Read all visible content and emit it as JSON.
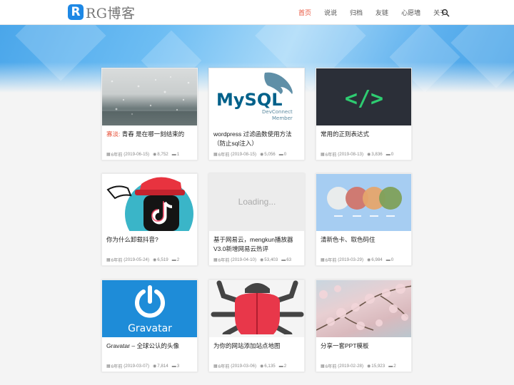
{
  "header": {
    "logo_letter": "R",
    "logo_text": "RG博客",
    "nav": [
      "首页",
      "说说",
      "归档",
      "友链",
      "心愿墙",
      "关于"
    ],
    "active_index": 0,
    "search_icon": "search-icon"
  },
  "colors": {
    "accent": "#e8543c",
    "brand": "#1e88e5",
    "hero": "#6dbdf3"
  },
  "posts": [
    {
      "title_prefix": "寡淡:",
      "title": "青春 是在哪一刻结束的",
      "age": "6年前",
      "date": "(2019-06-15)",
      "views": "8,752",
      "comments": "1",
      "thumb": "rainy-window"
    },
    {
      "title_prefix": "",
      "title": "wordpress 过滤函数使用方法（防止sql注入）",
      "age": "6年前",
      "date": "(2019-08-15)",
      "views": "5,056",
      "comments": "0",
      "thumb": "mysql-logo",
      "thumb_text": {
        "main": "MySQL",
        "sub1": "DevConnect",
        "sub2": "Member"
      }
    },
    {
      "title_prefix": "",
      "title": "常用的正则表达式",
      "age": "6年前",
      "date": "(2019-08-13)",
      "views": "3,836",
      "comments": "0",
      "thumb": "code-brackets",
      "thumb_text": {
        "main": "</>"
      }
    },
    {
      "title_prefix": "",
      "title": "你为什么卸载抖音?",
      "age": "6年前",
      "date": "(2019-05-24)",
      "views": "6,519",
      "comments": "2",
      "thumb": "tiktok-mascot"
    },
    {
      "title_prefix": "",
      "title": "基于网易云，mengkun播放器V3.0新增网易云热评",
      "age": "6年前",
      "date": "(2019-04-10)",
      "views": "53,403",
      "comments": "63",
      "thumb": "loading-placeholder",
      "thumb_text": {
        "main": "Loading..."
      }
    },
    {
      "title_prefix": "",
      "title": "清新色卡、取色码住",
      "age": "6年前",
      "date": "(2019-03-29)",
      "views": "6,984",
      "comments": "0",
      "thumb": "color-circles"
    },
    {
      "title_prefix": "",
      "title": "Gravatar – 全球公认的头像",
      "age": "6年前",
      "date": "(2019-03-07)",
      "views": "7,814",
      "comments": "3",
      "thumb": "gravatar-logo",
      "thumb_text": {
        "main": "Gravatar"
      }
    },
    {
      "title_prefix": "",
      "title": "为你的网站添加站点地图",
      "age": "6年前",
      "date": "(2019-03-06)",
      "views": "6,135",
      "comments": "2",
      "thumb": "bug-illustration"
    },
    {
      "title_prefix": "",
      "title": "分享一套PPT模板",
      "age": "6年前",
      "date": "(2019-02-28)",
      "views": "15,923",
      "comments": "2",
      "thumb": "cherry-blossom"
    }
  ]
}
